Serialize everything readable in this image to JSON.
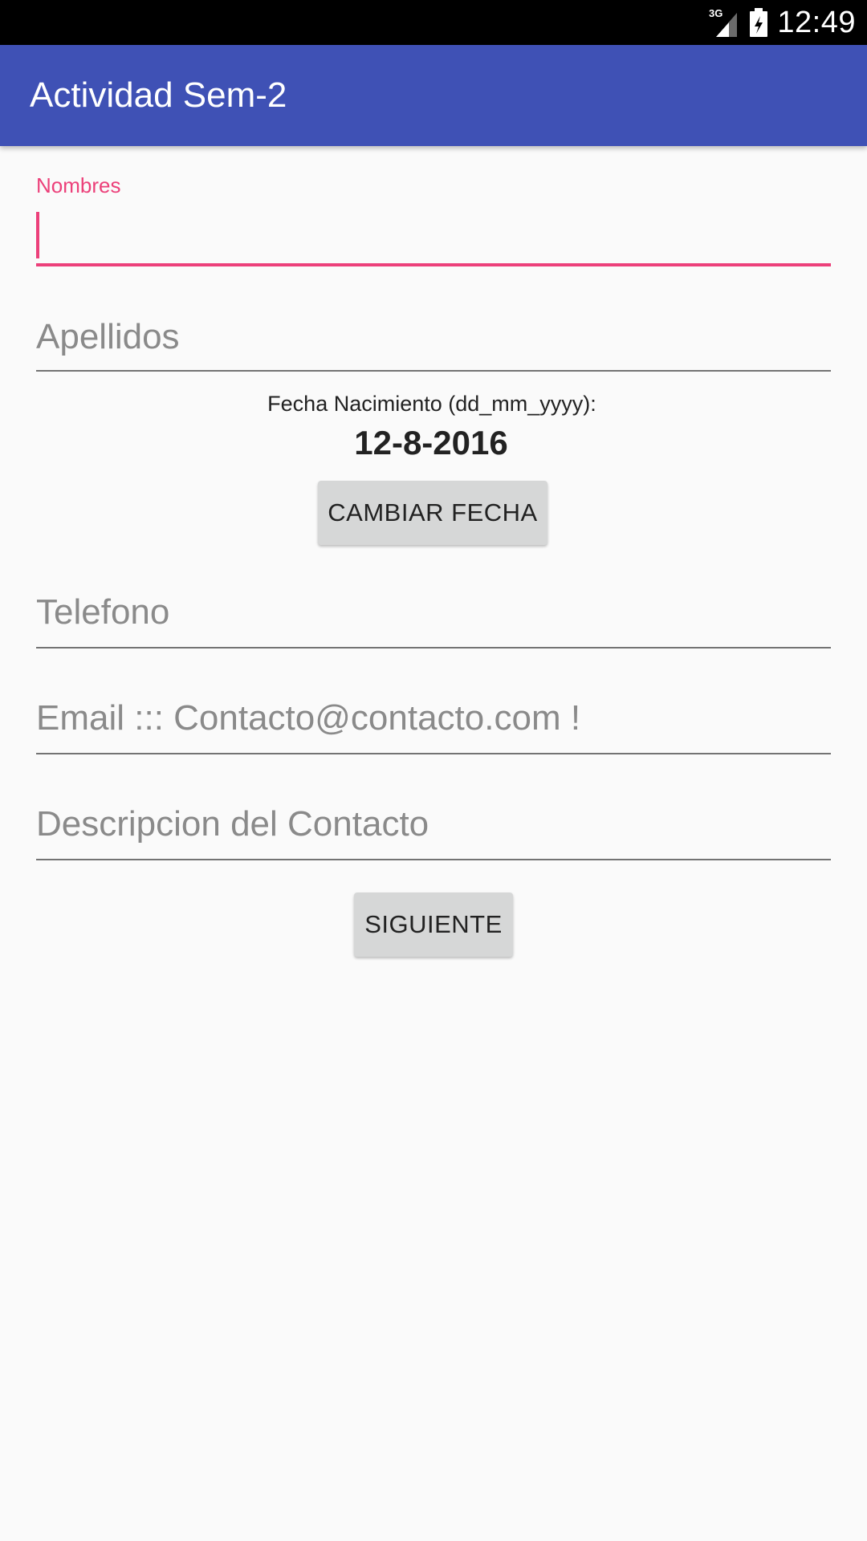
{
  "status_bar": {
    "network_type": "3G",
    "time": "12:49",
    "icons": [
      "network-signal-icon",
      "battery-icon"
    ]
  },
  "app_bar": {
    "title": "Actividad Sem-2",
    "color": "#3f51b5"
  },
  "form": {
    "nombres": {
      "label": "Nombres",
      "value": "",
      "focused": true
    },
    "apellidos": {
      "placeholder": "Apellidos",
      "value": ""
    },
    "birthdate": {
      "label": "Fecha Nacimiento (dd_mm_yyyy):",
      "value": "12-8-2016",
      "change_button": "CAMBIAR FECHA"
    },
    "telefono": {
      "placeholder": "Telefono",
      "value": ""
    },
    "email": {
      "placeholder": "Email ::: Contacto@contacto.com !",
      "value": ""
    },
    "descripcion": {
      "placeholder": "Descripcion del Contacto",
      "value": ""
    },
    "next_button": "SIGUIENTE"
  },
  "colors": {
    "accent": "#ec407a",
    "primary": "#3f51b5",
    "button": "#d6d7d7",
    "background": "#fafafa"
  }
}
